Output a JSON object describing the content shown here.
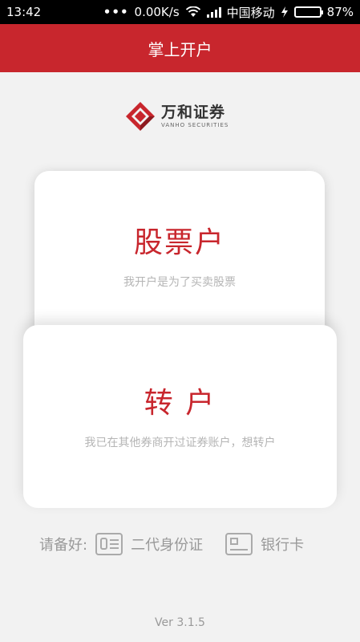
{
  "status_bar": {
    "time": "13:42",
    "network_speed": "0.00K/s",
    "carrier": "中国移动",
    "battery_percent": "87%"
  },
  "header": {
    "title": "掌上开户"
  },
  "logo": {
    "name_cn": "万和证券",
    "name_en": "VANHO SECURITIES"
  },
  "cards": [
    {
      "title": "股票户",
      "description": "我开户是为了买卖股票"
    },
    {
      "title": "转 户",
      "description": "我已在其他券商开过证券账户，想转户"
    }
  ],
  "prepare": {
    "label": "请备好:",
    "id_card": "二代身份证",
    "bank_card": "银行卡"
  },
  "footer": {
    "version": "Ver 3.1.5"
  },
  "colors": {
    "brand_red": "#c8262d",
    "battery_green": "#3ecb3e"
  }
}
